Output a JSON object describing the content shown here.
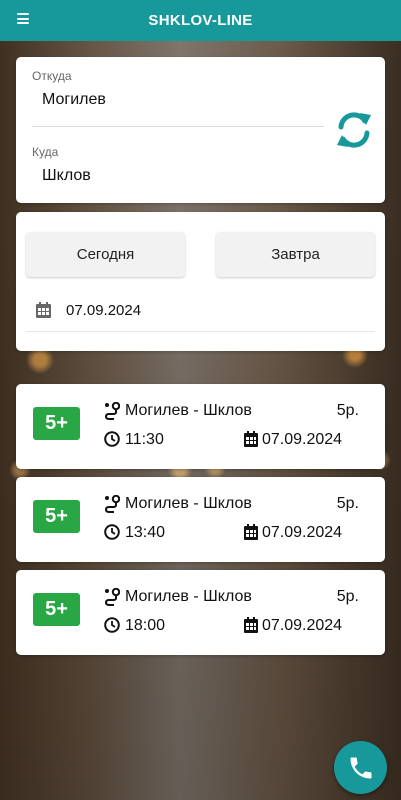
{
  "app": {
    "title": "SHKLOV-LINE"
  },
  "route": {
    "from_label": "Откуда",
    "from_value": "Могилев",
    "to_label": "Куда",
    "to_value": "Шклов"
  },
  "date_picker": {
    "today_label": "Сегодня",
    "tomorrow_label": "Завтра",
    "selected_date": "07.09.2024"
  },
  "trips": [
    {
      "age": "5+",
      "route": "Могилев - Шклов",
      "price": "5р.",
      "time": "11:30",
      "date": "07.09.2024"
    },
    {
      "age": "5+",
      "route": "Могилев - Шклов",
      "price": "5р.",
      "time": "13:40",
      "date": "07.09.2024"
    },
    {
      "age": "5+",
      "route": "Могилев - Шклов",
      "price": "5р.",
      "time": "18:00",
      "date": "07.09.2024"
    }
  ],
  "colors": {
    "accent": "#17999b",
    "badge_green": "#2aa745"
  },
  "icons": {
    "menu": "menu-icon",
    "swap": "swap-icon",
    "calendar": "calendar-icon",
    "route": "route-icon",
    "clock": "clock-icon",
    "phone": "phone-icon"
  }
}
